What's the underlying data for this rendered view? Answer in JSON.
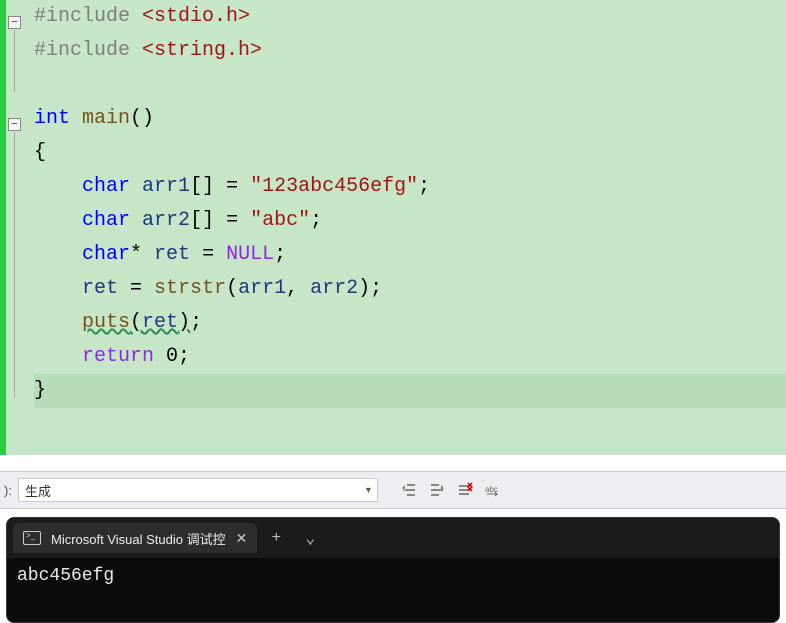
{
  "code": {
    "lines": [
      {
        "fold": true,
        "segs": [
          {
            "c": "kw-pp",
            "t": "#include "
          },
          {
            "c": "kw-str",
            "t": "<stdio.h>"
          }
        ]
      },
      {
        "segs": [
          {
            "c": "kw-pp",
            "t": "#include "
          },
          {
            "c": "kw-str",
            "t": "<string.h>"
          }
        ]
      },
      {
        "segs": [
          {
            "t": ""
          }
        ]
      },
      {
        "fold": true,
        "segs": [
          {
            "c": "kw-blue",
            "t": "int"
          },
          {
            "t": " "
          },
          {
            "c": "kw-func",
            "t": "main"
          },
          {
            "t": "()"
          }
        ]
      },
      {
        "segs": [
          {
            "t": "{"
          }
        ]
      },
      {
        "segs": [
          {
            "t": "    "
          },
          {
            "c": "kw-blue",
            "t": "char"
          },
          {
            "t": " "
          },
          {
            "c": "kw-var",
            "t": "arr1"
          },
          {
            "t": "[] = "
          },
          {
            "c": "kw-str",
            "t": "\"123abc456efg\""
          },
          {
            "t": ";"
          }
        ]
      },
      {
        "segs": [
          {
            "t": "    "
          },
          {
            "c": "kw-blue",
            "t": "char"
          },
          {
            "t": " "
          },
          {
            "c": "kw-var",
            "t": "arr2"
          },
          {
            "t": "[] = "
          },
          {
            "c": "kw-str",
            "t": "\"abc\""
          },
          {
            "t": ";"
          }
        ]
      },
      {
        "segs": [
          {
            "t": "    "
          },
          {
            "c": "kw-blue",
            "t": "char"
          },
          {
            "t": "* "
          },
          {
            "c": "kw-var",
            "t": "ret"
          },
          {
            "t": " = "
          },
          {
            "c": "kw-null",
            "t": "NULL"
          },
          {
            "t": ";"
          }
        ]
      },
      {
        "segs": [
          {
            "t": "    "
          },
          {
            "c": "kw-var",
            "t": "ret"
          },
          {
            "t": " = "
          },
          {
            "c": "kw-func",
            "t": "strstr"
          },
          {
            "t": "("
          },
          {
            "c": "kw-var",
            "t": "arr1"
          },
          {
            "t": ", "
          },
          {
            "c": "kw-var",
            "t": "arr2"
          },
          {
            "t": ");"
          }
        ]
      },
      {
        "segs": [
          {
            "t": "    "
          },
          {
            "c": "kw-func underline-green",
            "t": "puts"
          },
          {
            "c": "underline-green",
            "t": "("
          },
          {
            "c": "kw-var underline-green",
            "t": "ret"
          },
          {
            "c": "underline-green",
            "t": ")"
          },
          {
            "t": ";"
          }
        ]
      },
      {
        "segs": [
          {
            "t": "    "
          },
          {
            "c": "kw-null",
            "t": "return"
          },
          {
            "t": " 0;"
          }
        ]
      },
      {
        "hl": true,
        "segs": [
          {
            "t": "}"
          }
        ]
      }
    ]
  },
  "toolbar": {
    "prefix_label": "):",
    "dropdown_value": "生成"
  },
  "terminal": {
    "tab_title": "Microsoft Visual Studio 调试控",
    "output": "abc456efg"
  }
}
